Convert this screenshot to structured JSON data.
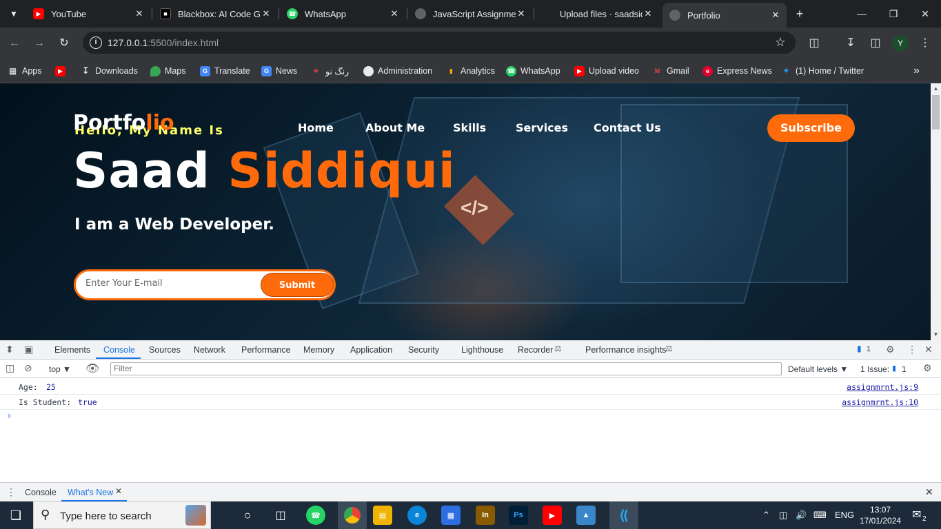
{
  "browser": {
    "tabs": [
      {
        "title": "YouTube",
        "icon": "youtube-icon",
        "color": "#ff0000"
      },
      {
        "title": "Blackbox: AI Code Ge",
        "icon": "blackbox-icon",
        "color": "#222222"
      },
      {
        "title": "WhatsApp",
        "icon": "whatsapp-icon",
        "color": "#25d366"
      },
      {
        "title": "JavaScript Assignmen",
        "icon": "globe-icon",
        "color": "#5f6368"
      },
      {
        "title": "Upload files · saadsid",
        "icon": "github-icon",
        "color": "#202124"
      },
      {
        "title": "Portfolio",
        "icon": "globe-icon",
        "color": "#5f6368"
      }
    ],
    "url_host": "127.0.0.1",
    "url_rest": ":5500/index.html",
    "avatar_letter": "Y",
    "bookmarks": [
      {
        "label": "Apps"
      },
      {
        "label": ""
      },
      {
        "label": "Downloads"
      },
      {
        "label": "Maps"
      },
      {
        "label": "Translate"
      },
      {
        "label": "News"
      },
      {
        "label": "رنگ نو"
      },
      {
        "label": "Administration"
      },
      {
        "label": "Analytics"
      },
      {
        "label": "WhatsApp"
      },
      {
        "label": "Upload video"
      },
      {
        "label": "Gmail"
      },
      {
        "label": "Express News"
      },
      {
        "label": "(1) Home / Twitter"
      }
    ]
  },
  "page": {
    "logo_main": "Portfo",
    "logo_accent": "lio",
    "hello": "Hello, My Name Is",
    "nav": [
      "Home",
      "About Me",
      "Skills",
      "Services",
      "Contact Us"
    ],
    "subscribe": "Subscribe",
    "name_first": "Saad",
    "name_last": "Siddiqui",
    "role": "I am a Web Developer.",
    "email_placeholder": "Enter Your E-mail",
    "submit": "Submit",
    "accent_color": "#ff6a0a"
  },
  "devtools": {
    "tabs": [
      "Elements",
      "Console",
      "Sources",
      "Network",
      "Performance",
      "Memory",
      "Application",
      "Security",
      "Lighthouse",
      "Recorder",
      "Performance insights"
    ],
    "issues_badge": "1",
    "context": "top",
    "filter_placeholder": "Filter",
    "levels": "Default levels",
    "issues_label": "1 Issue:",
    "issues_count": "1",
    "logs": [
      {
        "key": "Age:",
        "value": "25",
        "source": "assignmrnt.js:9"
      },
      {
        "key": "Is Student:",
        "value": "true",
        "source": "assignmrnt.js:10"
      }
    ],
    "prompt": "›",
    "drawer_tabs": [
      "Console",
      "What's New"
    ]
  },
  "taskbar": {
    "search_placeholder": "Type here to search",
    "lang": "ENG",
    "time": "13:07",
    "date": "17/01/2024",
    "notif_count": "2"
  }
}
